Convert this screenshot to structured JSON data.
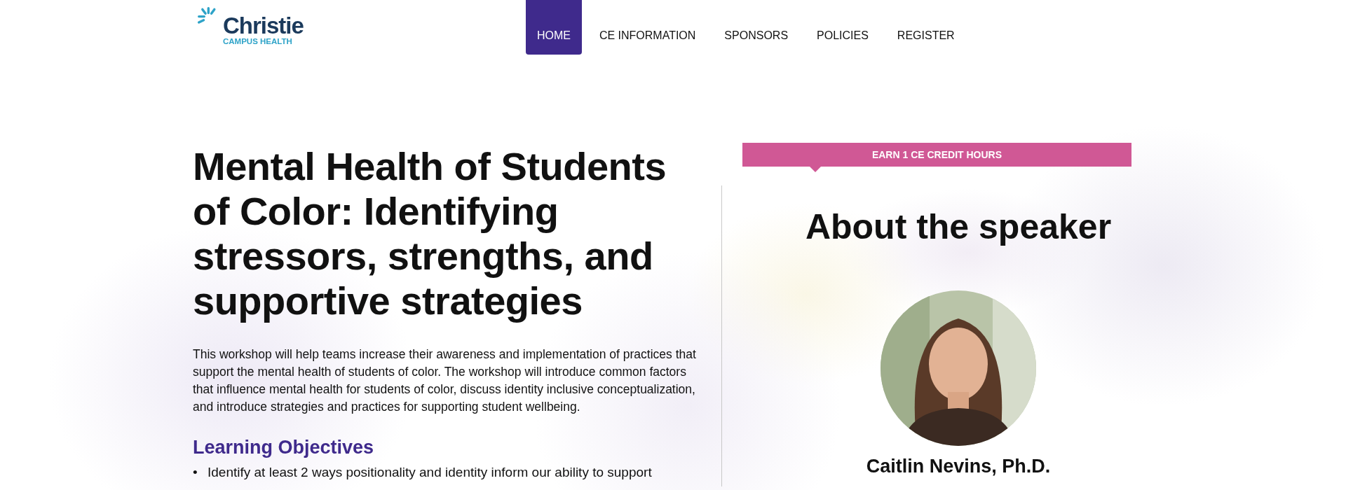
{
  "logo": {
    "name": "Christie",
    "tagline": "CAMPUS HEALTH"
  },
  "nav": [
    {
      "label": "HOME",
      "selected": true
    },
    {
      "label": "CE INFORMATION",
      "selected": false
    },
    {
      "label": "SPONSORS",
      "selected": false
    },
    {
      "label": "POLICIES",
      "selected": false
    },
    {
      "label": "REGISTER",
      "selected": false
    }
  ],
  "course": {
    "title": "Mental Health of Students of Color: Identifying stressors, strengths, and supportive strategies",
    "description": "This workshop will help teams increase their awareness and implementation of practices that support the mental health of students of color. The workshop will introduce common factors that influence mental health for students of color, discuss identity inclusive conceptualization, and introduce strategies and practices for supporting student wellbeing.",
    "objectives_heading": "Learning Objectives",
    "objectives": [
      {
        "bullet": "•",
        "text": "Identify at least 2 ways positionality and identity inform our ability to support"
      }
    ]
  },
  "credit_badge": "EARN 1 CE CREDIT HOURS",
  "speaker": {
    "heading": "About the speaker",
    "name": "Caitlin Nevins, Ph.D."
  }
}
